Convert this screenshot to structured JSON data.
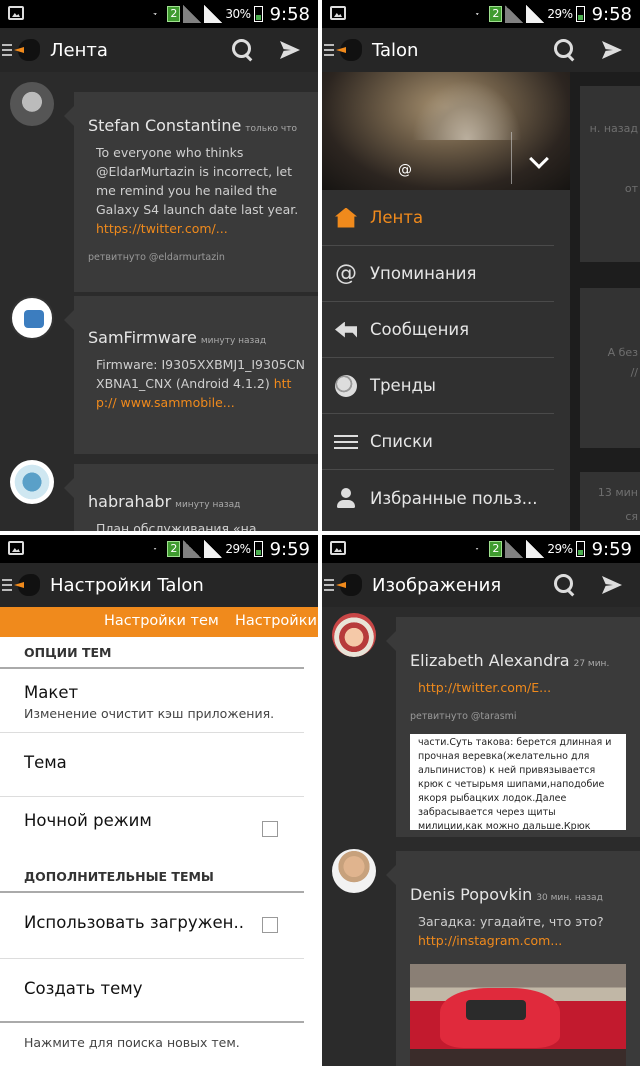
{
  "status": {
    "sim_label": "2",
    "p1": {
      "battery": "30%",
      "time": "9:58"
    },
    "p2": {
      "battery": "29%",
      "time": "9:58"
    },
    "p3": {
      "battery": "29%",
      "time": "9:59"
    },
    "p4": {
      "battery": "29%",
      "time": "9:59"
    }
  },
  "timeline": {
    "title": "Лента",
    "tweets": [
      {
        "name": "Stefan Constantine",
        "time": "только что",
        "text": "To everyone who thinks @EldarMurtazin is incorrect, let me remind you he nailed the Galaxy S4 launch date last year. ",
        "link": "https://twitter.com/...",
        "retweet": "ретвитнуто @eldarmurtazin"
      },
      {
        "name": "SamFirmware",
        "time": "минуту назад",
        "text": "Firmware: I9305XXBMJ1_I9305CNXBNA1_CNX (Android 4.1.2) ",
        "link": "http:// www.sammobile..."
      },
      {
        "name": "habrahabr",
        "time": "минуту назад",
        "text": "План обслуживания «на"
      }
    ]
  },
  "drawer_screen": {
    "title": "Talon",
    "handle": "@",
    "menu": [
      {
        "label": "Лента",
        "icon": "home-icon",
        "active": true
      },
      {
        "label": "Упоминания",
        "icon": "at-icon"
      },
      {
        "label": "Сообщения",
        "icon": "reply-icon"
      },
      {
        "label": "Тренды",
        "icon": "globe-icon"
      },
      {
        "label": "Списки",
        "icon": "list-icon"
      },
      {
        "label": "Избранные польз...",
        "icon": "person-icon"
      }
    ],
    "bg_snippets": [
      "н. назад",
      "от",
      "А без",
      "//",
      "13 мин",
      "ся"
    ]
  },
  "settings": {
    "title": "Настройки Talon",
    "tabs": [
      "Настройки тем",
      "Настройки"
    ],
    "section1": "ОПЦИИ ТЕМ",
    "layout": {
      "title": "Макет",
      "subtitle": "Изменение очистит кэш приложения."
    },
    "theme": "Тема",
    "night": "Ночной режим",
    "section2": "ДОПОЛНИТЕЛЬНЫЕ ТЕМЫ",
    "use_downloaded": "Использовать загружен..",
    "create": "Создать тему",
    "search_hint": "Нажмите для поиска новых тем."
  },
  "images": {
    "title": "Изображения",
    "tweets": [
      {
        "name": "Elizabeth Alexandra",
        "time": "27 мин.",
        "link": "http://twitter.com/E...",
        "retweet": "ретвитнуто @tarasmi",
        "image_text": "части.Суть такова: берется длинная и прочная веревка(желательно для альпинистов) к ней привязывается крюк с четырьмя шипами,наподобие якоря рыбацких лодок.Далее забрасывается через щиты милиции,как можно дальше.Крюк цепляется хоть за кого то,они стоят плотной стеной.Потом"
      },
      {
        "name": "Denis Popovkin",
        "time": "30 мин. назад",
        "text": "Загадка: угадайте, что это?",
        "link": "http://instagram.com..."
      }
    ]
  },
  "colors": {
    "accent": "#f08a1c",
    "background": "#2b2b2b",
    "card": "#3a3a3a"
  }
}
